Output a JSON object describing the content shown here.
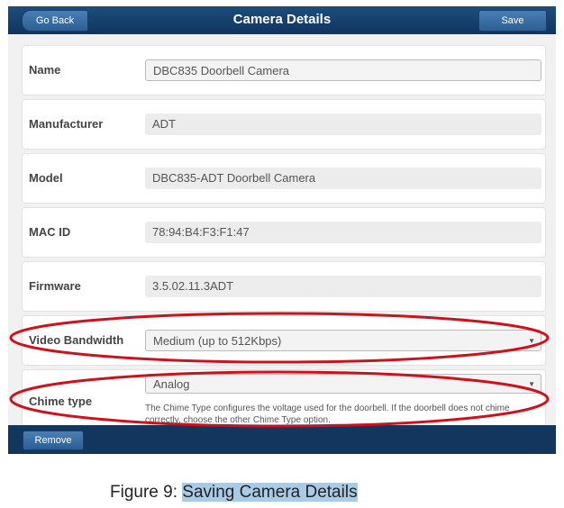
{
  "header": {
    "back_label": "Go Back",
    "title": "Camera Details",
    "save_label": "Save"
  },
  "fields": [
    {
      "label": "Name",
      "value": "DBC835 Doorbell Camera"
    },
    {
      "label": "Manufacturer",
      "value": "ADT"
    },
    {
      "label": "Model",
      "value": "DBC835-ADT Doorbell Camera"
    },
    {
      "label": "MAC ID",
      "value": "78:94:B4:F3:F1:47"
    },
    {
      "label": "Firmware",
      "value": "3.5.02.11.3ADT"
    },
    {
      "label": "Video Bandwidth",
      "value": "Medium (up to 512Kbps)"
    },
    {
      "label": "Chime type",
      "value": "Analog",
      "help": "The Chime Type configures the voltage used for the doorbell. If the doorbell does not chime correctly, choose the other Chime Type option."
    }
  ],
  "footer": {
    "remove_label": "Remove"
  },
  "caption": {
    "prefix": "Figure 9: ",
    "highlight": "Saving Camera Details"
  },
  "colors": {
    "header": "#1e4d7c",
    "annotation": "#d0101a"
  }
}
